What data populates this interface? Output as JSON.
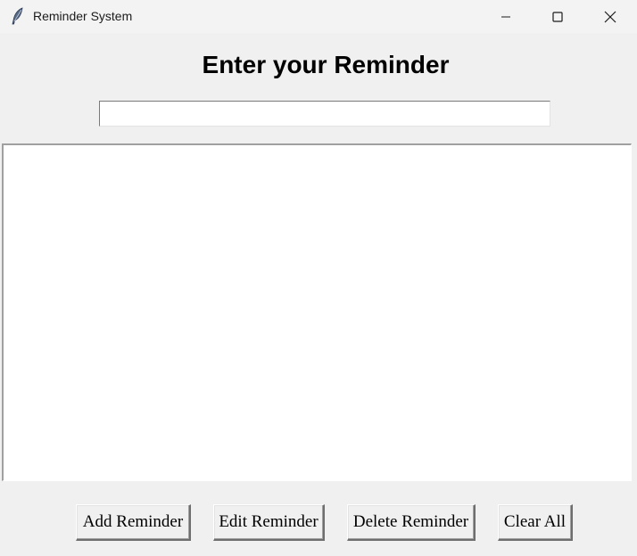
{
  "window": {
    "title": "Reminder System",
    "icon": "feather-icon",
    "controls": {
      "minimize": "minimize-icon",
      "maximize": "maximize-icon",
      "close": "close-icon"
    }
  },
  "main": {
    "heading": "Enter your Reminder",
    "reminder_input": {
      "value": "",
      "placeholder": ""
    },
    "reminders_list": {
      "items": []
    }
  },
  "buttons": {
    "add": "Add Reminder",
    "edit": "Edit Reminder",
    "delete": "Delete Reminder",
    "clear": "Clear All"
  }
}
